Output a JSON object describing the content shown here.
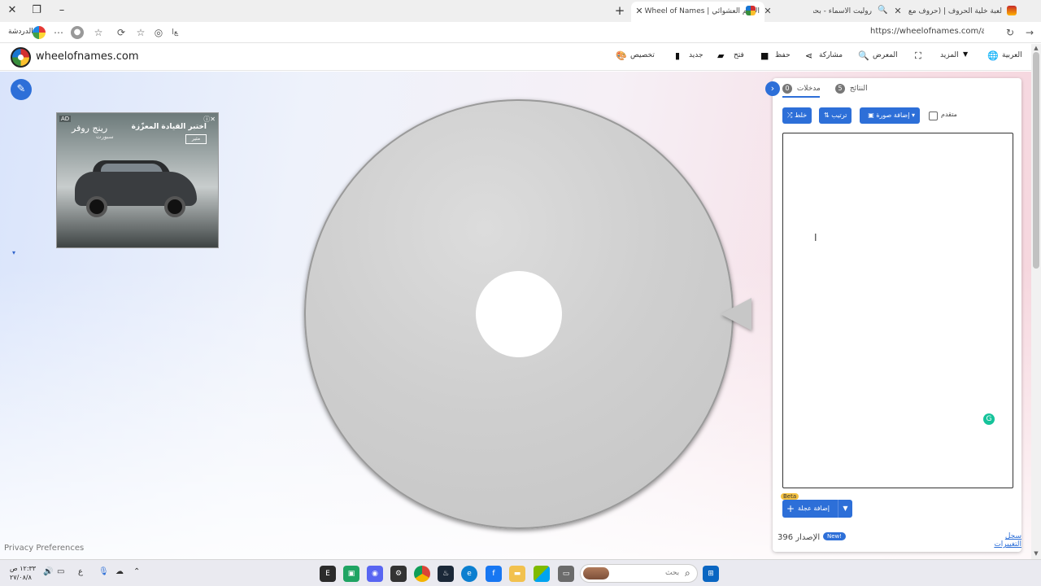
{
  "browser": {
    "tabs": [
      {
        "title": "لعبة خلية الحروف | (حروف مع عزيز) -",
        "active": false
      },
      {
        "title": "روليت الاسماء - بحث",
        "active": false
      },
      {
        "title": "الاسم العشوائي | Wheel of Names",
        "active": true
      }
    ],
    "url": "https://wheelofnames.com/ar",
    "profile_label": "الدردشة"
  },
  "site": {
    "name": "wheelofnames.com",
    "nav": {
      "language": "العربية",
      "more": "المزيد",
      "gallery": "المعرض",
      "share": "مشاركة",
      "save": "حفظ",
      "open": "فتح",
      "new": "جديد",
      "customize": "تخصيص"
    }
  },
  "ad": {
    "tag": "AD",
    "title": "اختبر القيادة المعزّزة",
    "brand": "رينج روفر",
    "sub": "سبورت",
    "cta": "مثير"
  },
  "panel": {
    "tabs": [
      {
        "label": "مدخلات",
        "count": "0"
      },
      {
        "label": "النتائج",
        "count": "5"
      }
    ],
    "buttons": {
      "shuffle": "خلط",
      "sort": "ترتيب",
      "add_image": "إضافة صورة",
      "advanced": "متقدم"
    },
    "add_wheel": "إضافة عجلة",
    "beta": "Beta",
    "version": "396 الإصدار",
    "new_badge": "New!",
    "changelog": "سجل التغييرات"
  },
  "privacy": "Privacy Preferences",
  "taskbar": {
    "search_placeholder": "بحث",
    "time": "١٢:٣٣ ص",
    "date": "٢٧/٠٨/٨"
  },
  "colors": {
    "accent": "#2d6fd8",
    "wheel": "#cfcfcf"
  }
}
